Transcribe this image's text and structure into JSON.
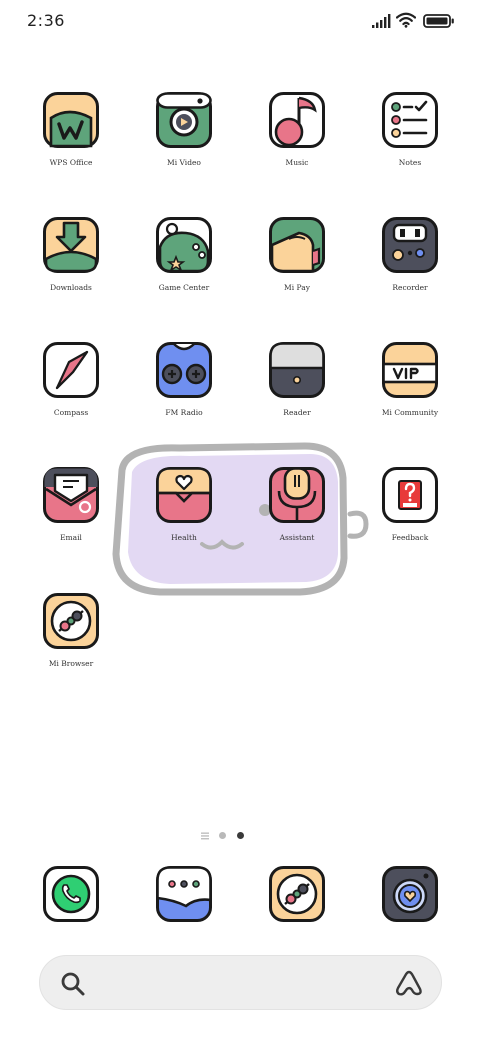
{
  "status_bar": {
    "time": "2:36",
    "icons": [
      "signal-icon",
      "wifi-icon",
      "battery-icon"
    ]
  },
  "home": {
    "apps": [
      {
        "label": "WPS Office",
        "icon": "wps-office-icon"
      },
      {
        "label": "Mi Video",
        "icon": "mi-video-icon"
      },
      {
        "label": "Music",
        "icon": "music-icon"
      },
      {
        "label": "Notes",
        "icon": "notes-icon"
      },
      {
        "label": "Downloads",
        "icon": "downloads-icon"
      },
      {
        "label": "Game Center",
        "icon": "game-center-icon"
      },
      {
        "label": "Mi Pay",
        "icon": "mi-pay-icon"
      },
      {
        "label": "Recorder",
        "icon": "recorder-icon"
      },
      {
        "label": "Compass",
        "icon": "compass-icon"
      },
      {
        "label": "FM Radio",
        "icon": "fm-radio-icon"
      },
      {
        "label": "Reader",
        "icon": "reader-icon"
      },
      {
        "label": "Mi Community",
        "icon": "mi-community-icon"
      },
      {
        "label": "Email",
        "icon": "email-icon"
      },
      {
        "label": "Health",
        "icon": "health-icon"
      },
      {
        "label": "Assistant",
        "icon": "assistant-icon"
      },
      {
        "label": "Feedback",
        "icon": "feedback-icon"
      },
      {
        "label": "Mi Browser",
        "icon": "mi-browser-icon"
      }
    ],
    "page_indicator": {
      "pages": 2,
      "current": 2
    }
  },
  "dock": {
    "apps": [
      "phone-icon",
      "messages-icon",
      "browser-icon",
      "camera-icon"
    ]
  },
  "search": {
    "placeholder": "",
    "icons": [
      "search-icon",
      "assistant-triangle-icon"
    ]
  },
  "colors": {
    "outline": "#1a1a1a",
    "peach": "#fbd39a",
    "green": "#5ea47b",
    "pink": "#e87589",
    "blue": "#6f8ff0",
    "gray": "#4d4f5c",
    "lavender": "#e2d9f2"
  }
}
